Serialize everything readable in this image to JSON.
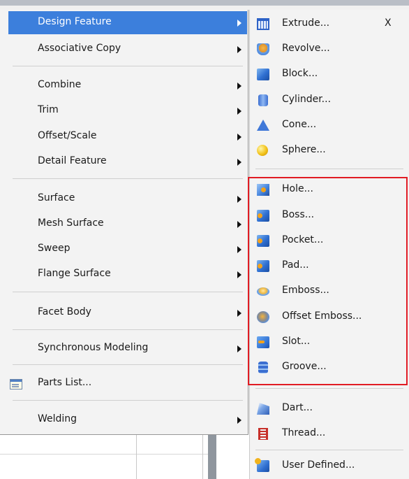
{
  "main_menu": {
    "items": [
      {
        "label": "Design Feature",
        "submenu": true,
        "highlighted": true
      },
      {
        "label": "Associative Copy",
        "submenu": true
      },
      {
        "label": "Combine",
        "submenu": true
      },
      {
        "label": "Trim",
        "submenu": true
      },
      {
        "label": "Offset/Scale",
        "submenu": true
      },
      {
        "label": "Detail Feature",
        "submenu": true
      },
      {
        "label": "Surface",
        "submenu": true
      },
      {
        "label": "Mesh Surface",
        "submenu": true
      },
      {
        "label": "Sweep",
        "submenu": true
      },
      {
        "label": "Flange Surface",
        "submenu": true
      },
      {
        "label": "Facet Body",
        "submenu": true
      },
      {
        "label": "Synchronous Modeling",
        "submenu": true
      },
      {
        "label": "Parts List...",
        "icon": "parts-list-icon"
      },
      {
        "label": "Welding",
        "submenu": true
      }
    ]
  },
  "submenu": {
    "items": [
      {
        "label": "Extrude...",
        "shortcut": "X",
        "icon": "extrude-icon"
      },
      {
        "label": "Revolve...",
        "icon": "revolve-icon"
      },
      {
        "label": "Block...",
        "icon": "block-icon"
      },
      {
        "label": "Cylinder...",
        "icon": "cylinder-icon"
      },
      {
        "label": "Cone...",
        "icon": "cone-icon"
      },
      {
        "label": "Sphere...",
        "icon": "sphere-icon"
      },
      {
        "label": "Hole...",
        "icon": "hole-icon"
      },
      {
        "label": "Boss...",
        "icon": "boss-icon"
      },
      {
        "label": "Pocket...",
        "icon": "pocket-icon"
      },
      {
        "label": "Pad...",
        "icon": "pad-icon"
      },
      {
        "label": "Emboss...",
        "icon": "emboss-icon"
      },
      {
        "label": "Offset Emboss...",
        "icon": "offset-emboss-icon"
      },
      {
        "label": "Slot...",
        "icon": "slot-icon"
      },
      {
        "label": "Groove...",
        "icon": "groove-icon"
      },
      {
        "label": "Dart...",
        "icon": "dart-icon"
      },
      {
        "label": "Thread...",
        "icon": "thread-icon"
      },
      {
        "label": "User Defined...",
        "icon": "user-defined-icon"
      }
    ]
  },
  "colors": {
    "highlight": "#3c7fdc",
    "annotation_box": "#e11c24",
    "menu_background": "#f3f3f3"
  }
}
